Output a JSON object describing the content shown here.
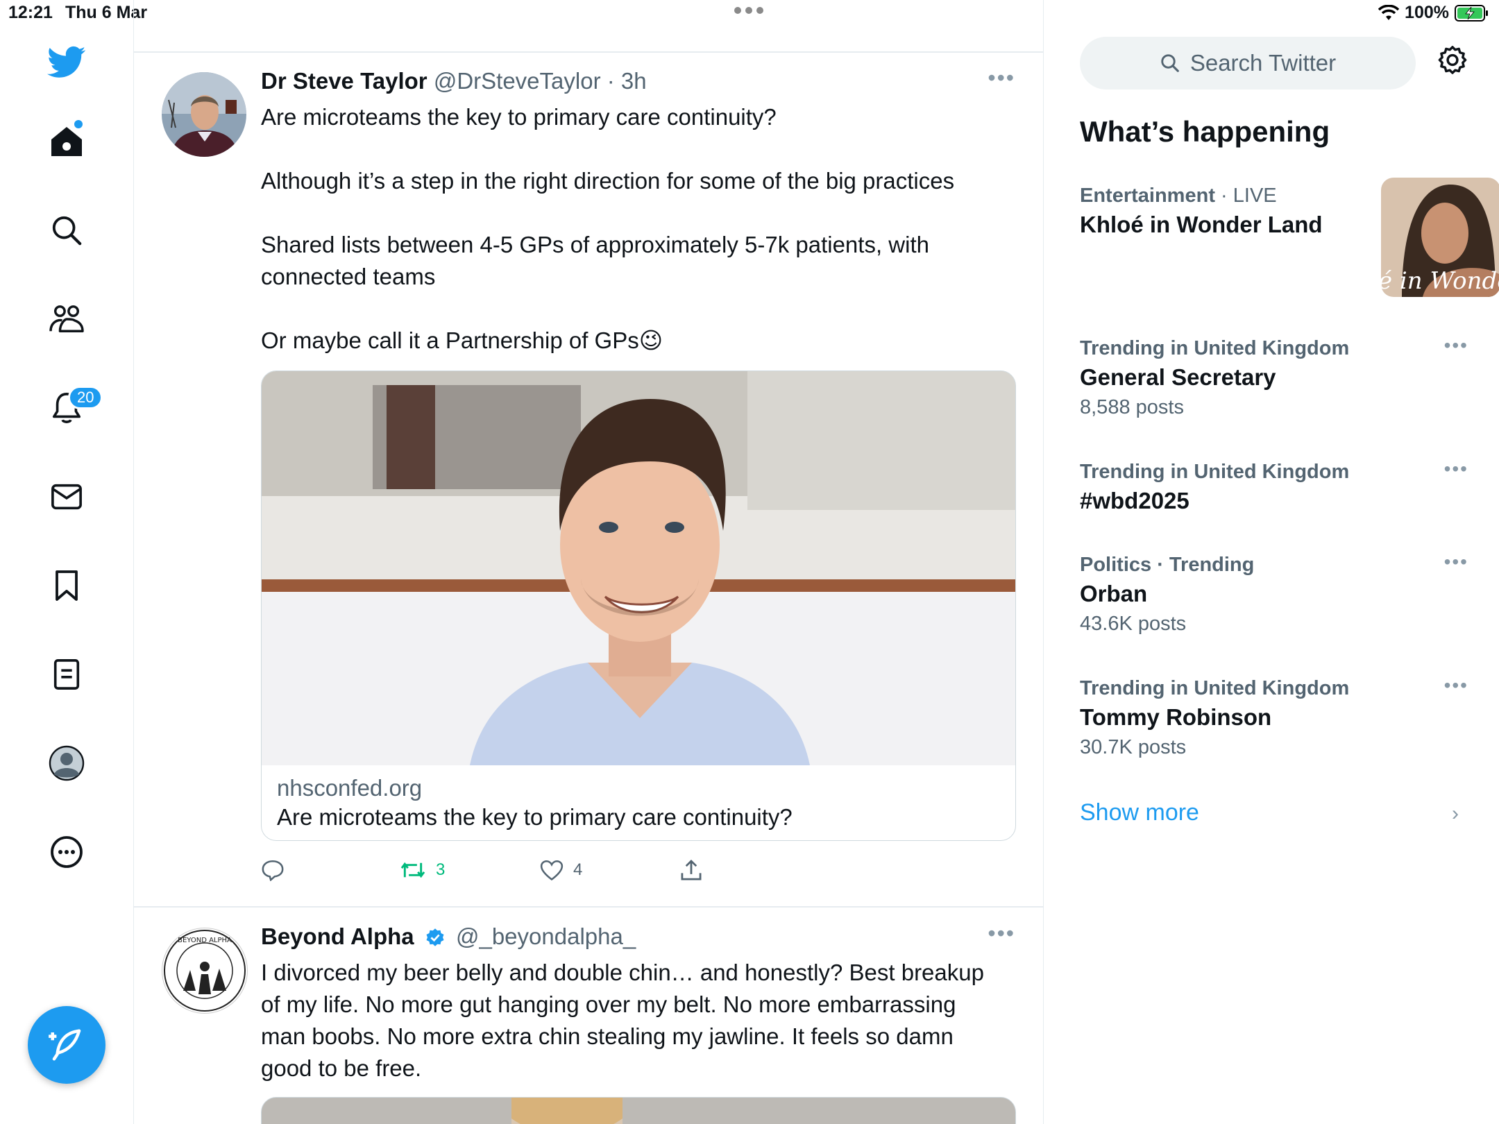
{
  "status_bar": {
    "time": "12:21",
    "date": "Thu 6 Mar",
    "battery": "100%"
  },
  "nav": {
    "notifications_badge": "20"
  },
  "tweets": [
    {
      "name": "Dr Steve Taylor",
      "handle": "@DrSteveTaylor",
      "time": "· 3h",
      "paragraphs": [
        "Are microteams the key to primary care continuity?",
        "Although it’s a step in the right direction for some of the big practices",
        "Shared lists between 4-5 GPs of approximately 5-7k patients, with connected teams",
        "Or maybe call it a Partnership of GPs😉"
      ],
      "card": {
        "domain": "nhsconfed.org",
        "title": "Are microteams the key to primary care continuity?"
      },
      "actions": {
        "retweets": "3",
        "likes": "4"
      }
    },
    {
      "name": "Beyond Alpha",
      "handle": "@_beyondalpha_",
      "verified": true,
      "text": "I divorced my beer belly and double chin… and honestly? Best breakup of my life. No more gut hanging over my belt. No more embarrassing man boobs. No more extra chin stealing my jawline. It feels so damn good to be free."
    }
  ],
  "sidebar": {
    "search_placeholder": "Search Twitter",
    "title": "What’s happening",
    "featured": {
      "category": "Entertainment",
      "live": "· LIVE",
      "headline": "Khloé in Wonder Land",
      "thumb_text": "é in Wonder L"
    },
    "trends": [
      {
        "context": "Trending in United Kingdom",
        "name": "General Secretary",
        "count": "8,588 posts"
      },
      {
        "context": "Trending in United Kingdom",
        "name": "#wbd2025",
        "count": ""
      },
      {
        "context": "Politics · Trending",
        "name": "Orban",
        "count": "43.6K posts"
      },
      {
        "context": "Trending in United Kingdom",
        "name": "Tommy Robinson",
        "count": "30.7K posts"
      }
    ],
    "show_more": "Show more"
  },
  "colors": {
    "accent": "#1d9bf0",
    "retweet_green": "#00ba7c",
    "muted": "#536471"
  }
}
